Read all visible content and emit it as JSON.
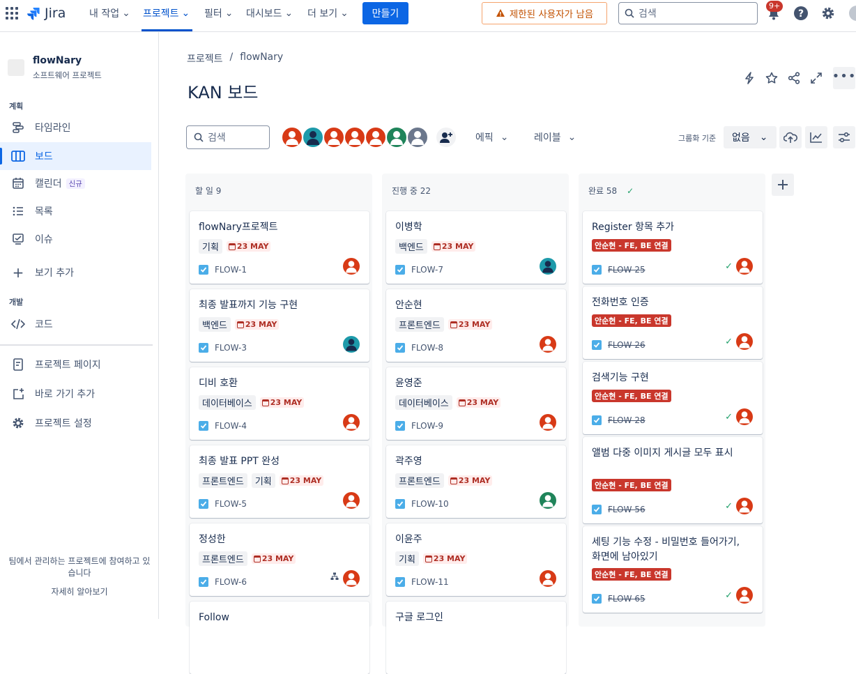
{
  "app": {
    "logo_text": "Jira"
  },
  "nav": {
    "items": [
      "내 작업",
      "프로젝트",
      "필터",
      "대시보드",
      "더 보기"
    ],
    "create": "만들기",
    "warning": "제한된 사용자가 남음",
    "search_placeholder": "검색",
    "notif_badge": "9+"
  },
  "sidebar": {
    "project_name": "flowNary",
    "project_type": "소프트웨어 프로젝트",
    "section_plan": "계획",
    "timeline": "타임라인",
    "board": "보드",
    "calendar": "캘린더",
    "calendar_badge": "신규",
    "list": "목록",
    "issues": "이슈",
    "add_view": "보기 추가",
    "section_dev": "개발",
    "code": "코드",
    "project_pages": "프로젝트 페이지",
    "add_shortcut": "바로 가기 추가",
    "project_settings": "프로젝트 설정",
    "footer_line1": "팀에서 관리하는 프로젝트에 참여하고 있",
    "footer_line2": "습니다",
    "learn_more": "자세히 알아보기"
  },
  "main": {
    "breadcrumb_root": "프로젝트",
    "breadcrumb_sep": "/",
    "breadcrumb_project": "flowNary",
    "title": "KAN 보드",
    "search_placeholder": "검색",
    "epic_filter": "에픽",
    "label_filter": "레이블",
    "group_label": "그룹화 기준",
    "group_value": "없음"
  },
  "colors": {
    "accent": "#0c66e4",
    "avatar_red": "#d83a16",
    "avatar_teal": "#1d9aaa",
    "avatar_green": "#1f845a",
    "avatar_gray": "#6b778c"
  },
  "columns": [
    {
      "title": "할 일 9",
      "cards": [
        {
          "title": "flowNary프로젝트",
          "tags": [
            "기획"
          ],
          "due": "23 MAY",
          "key": "FLOW-1",
          "avatar": "red"
        },
        {
          "title": "최종 발표까지 기능 구현",
          "tags": [
            "백엔드"
          ],
          "due": "23 MAY",
          "key": "FLOW-3",
          "avatar": "teal"
        },
        {
          "title": "디비 호환",
          "tags": [
            "데이터베이스"
          ],
          "due": "23 MAY",
          "key": "FLOW-4",
          "avatar": "red"
        },
        {
          "title": "최종 발표 PPT 완성",
          "tags": [
            "프론트엔드",
            "기획"
          ],
          "due": "23 MAY",
          "key": "FLOW-5",
          "avatar": "red"
        },
        {
          "title": "정성한",
          "tags": [
            "프론트엔드"
          ],
          "due": "23 MAY",
          "key": "FLOW-6",
          "avatar": "red",
          "subtask": true
        },
        {
          "title": "Follow",
          "tags": [],
          "due": "",
          "key": "",
          "avatar": ""
        }
      ]
    },
    {
      "title": "진행 중 22",
      "cards": [
        {
          "title": "이병학",
          "tags": [
            "백엔드"
          ],
          "due": "23 MAY",
          "key": "FLOW-7",
          "avatar": "teal"
        },
        {
          "title": "안순현",
          "tags": [
            "프론트엔드"
          ],
          "due": "23 MAY",
          "key": "FLOW-8",
          "avatar": "red"
        },
        {
          "title": "윤영준",
          "tags": [
            "데이터베이스"
          ],
          "due": "23 MAY",
          "key": "FLOW-9",
          "avatar": "red"
        },
        {
          "title": "곽주영",
          "tags": [
            "프론트엔드"
          ],
          "due": "23 MAY",
          "key": "FLOW-10",
          "avatar": "green"
        },
        {
          "title": "이윤주",
          "tags": [
            "기획"
          ],
          "due": "23 MAY",
          "key": "FLOW-11",
          "avatar": "red"
        },
        {
          "title": "구글 로그인",
          "tags": [],
          "due": "",
          "key": "",
          "avatar": ""
        }
      ]
    },
    {
      "title": "완료 58",
      "cards": [
        {
          "title": "Register 항목 추가",
          "epic": "안순현 - FE, BE 연결",
          "key": "FLOW-25",
          "avatar": "red"
        },
        {
          "title": "전화번호 인증",
          "epic": "안순현 - FE, BE 연결",
          "key": "FLOW-26",
          "avatar": "red"
        },
        {
          "title": "검색기능 구현",
          "epic": "안순현 - FE, BE 연결",
          "key": "FLOW-28",
          "avatar": "red"
        },
        {
          "title": "앨범 다중 이미지 게시글 모두 표시",
          "epic": "안순현 - FE, BE 연결",
          "key": "FLOW-56",
          "avatar": "red"
        },
        {
          "title": "세팅 기능 수정 - 비밀번호 들어가기, 화면에 남아있기",
          "epic": "안순현 - FE, BE 연결",
          "key": "FLOW-65",
          "avatar": "red"
        }
      ]
    }
  ]
}
